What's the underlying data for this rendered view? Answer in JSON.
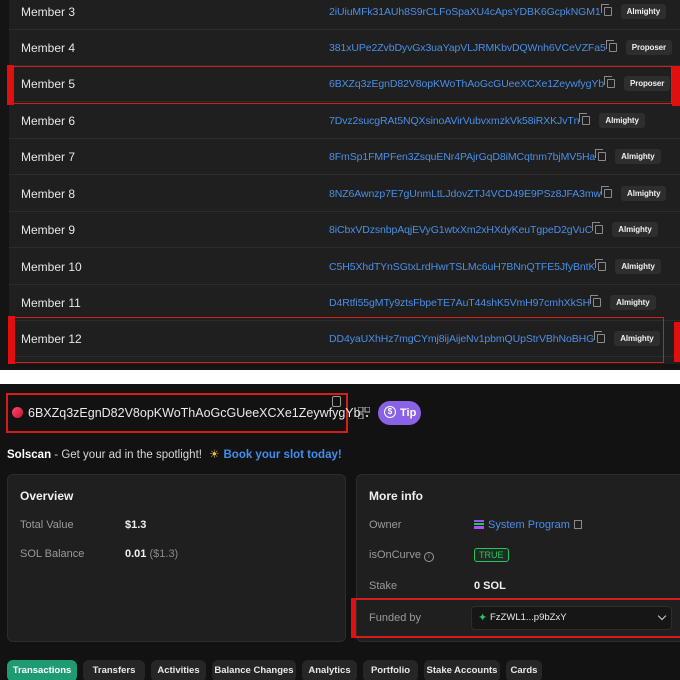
{
  "members": [
    {
      "label": "Member 3",
      "address": "2iUiuMFk31AUh8S9rCLFoSpaXU4cApsYDBK6GcpkNGM1",
      "role": "Almighty"
    },
    {
      "label": "Member 4",
      "address": "381xUPe2ZvbDyvGx3uaYapVLJRMKbvDQWnh6VCeVZFa5",
      "role": "Proposer"
    },
    {
      "label": "Member 5",
      "address": "6BXZq3zEgnD82V8opKWoThAoGcGUeeXCXe1ZeywfygYb",
      "role": "Proposer"
    },
    {
      "label": "Member 6",
      "address": "7Dvz2sucgRAt5NQXsinoAVirVubvxmzkVk58iRXKJvTn",
      "role": "Almighty"
    },
    {
      "label": "Member 7",
      "address": "8FmSp1FMPFen3ZsquENr4PAjrGqD8iMCqtnm7bjMV5Ha",
      "role": "Almighty"
    },
    {
      "label": "Member 8",
      "address": "8NZ6Awnzp7E7gUnmLtLJdovZTJ4VCD49E9PSz8JFA3mw",
      "role": "Almighty"
    },
    {
      "label": "Member 9",
      "address": "8iCbxVDzsnbpAqjEVyG1wtxXm2xHXdyKeuTgpeD2gVuC",
      "role": "Almighty"
    },
    {
      "label": "Member 10",
      "address": "C5H5XhdTYnSGtxLrdHwrTSLMc6uH7BNnQTFE5JfyBntK",
      "role": "Almighty"
    },
    {
      "label": "Member 11",
      "address": "D4Rtfi55gMTy9ztsFbpeTE7AuT44shK5VmH97cmhXkSH",
      "role": "Almighty"
    },
    {
      "label": "Member 12",
      "address": "DD4yaUXhHz7mgCYmj8ijAijeNv1pbmQUpStrVBhNoBHG",
      "role": "Almighty"
    }
  ],
  "account": {
    "address": "6BXZq3zEgnD82V8opKWoThAoGcGUeeXCXe1ZeywfygYb",
    "tip_label": "Tip"
  },
  "ad": {
    "brand": "Solscan",
    "text": " - Get your ad in the spotlight! ",
    "cta": "Book your slot today!"
  },
  "overview": {
    "title": "Overview",
    "total_value_label": "Total Value",
    "total_value": "$1.3",
    "sol_balance_label": "SOL Balance",
    "sol_balance": "0.01",
    "sol_balance_usd": "($1.3)"
  },
  "more_info": {
    "title": "More info",
    "owner_label": "Owner",
    "owner_value": "System Program",
    "oncurve_label": "isOnCurve",
    "oncurve_value": "TRUE",
    "stake_label": "Stake",
    "stake_value": "0 SOL",
    "funded_label": "Funded by",
    "funded_value": "FzZWL1...p9bZxY"
  },
  "tabs": [
    "Transactions",
    "Transfers",
    "Activities",
    "Balance Changes",
    "Analytics",
    "Portfolio",
    "Stake Accounts",
    "Cards"
  ],
  "colors": {
    "link": "#4a8fe8",
    "highlight": "#d81b1b",
    "active_tab": "#1f9b74",
    "tip": "#8a62e6",
    "true_badge": "#22c55e"
  }
}
